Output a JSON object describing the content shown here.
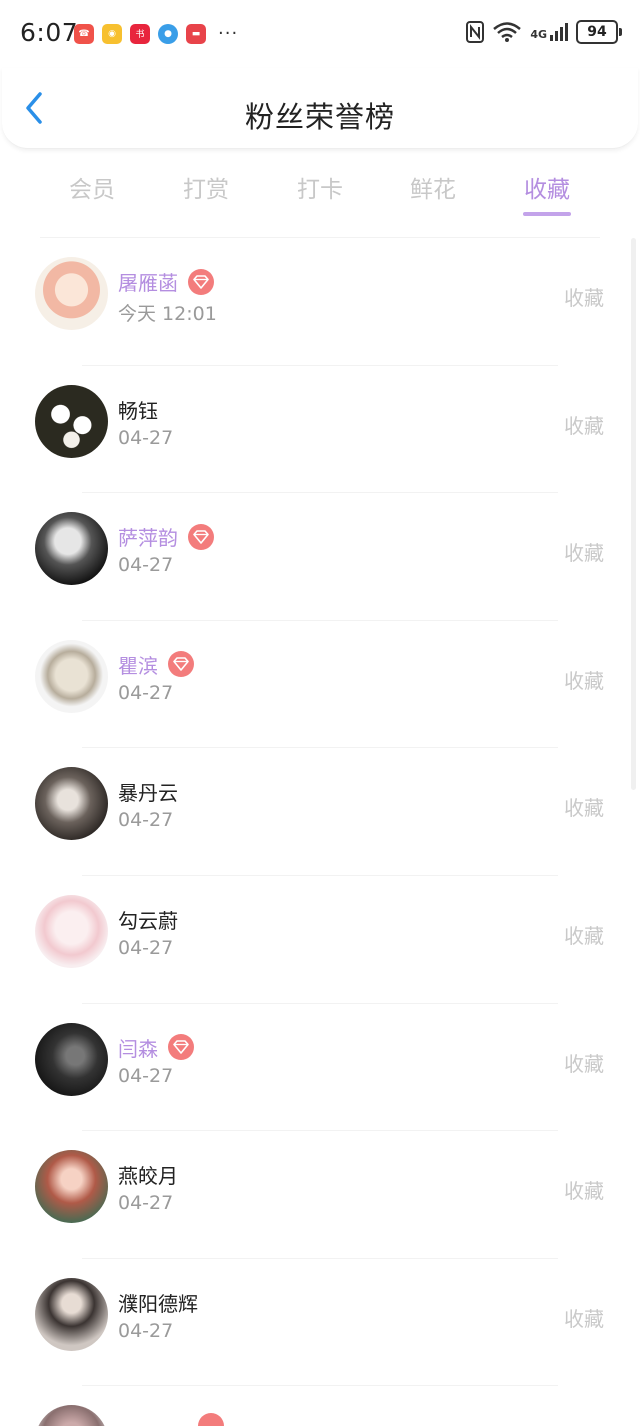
{
  "status_bar": {
    "time": "6:07",
    "network": "4G",
    "battery": "94",
    "app_icons": [
      {
        "name": "call-app-icon",
        "color": "#f0524a"
      },
      {
        "name": "weibo-app-icon",
        "color": "#f7c02f"
      },
      {
        "name": "xiaohongshu-app-icon",
        "color": "#e8253d"
      },
      {
        "name": "blue-app-icon",
        "color": "#3a9ee8"
      },
      {
        "name": "huawei-app-icon",
        "color": "#e8434a"
      }
    ]
  },
  "header": {
    "title": "粉丝荣誉榜"
  },
  "tabs": [
    {
      "label": "会员"
    },
    {
      "label": "打赏"
    },
    {
      "label": "打卡"
    },
    {
      "label": "鲜花"
    },
    {
      "label": "收藏"
    }
  ],
  "active_tab": "收藏",
  "colors": {
    "accent": "#b48ee0",
    "badge": "#f37c7c",
    "back_arrow": "#2a8fe8"
  },
  "fans": [
    {
      "name": "屠雁菡",
      "vip": true,
      "date": "今天 12:01",
      "action": "收藏",
      "avatar": "anime-girl-avatar"
    },
    {
      "name": "畅钰",
      "vip": false,
      "date": "04-27",
      "action": "收藏",
      "avatar": "white-flowers-avatar"
    },
    {
      "name": "萨萍韵",
      "vip": true,
      "date": "04-27",
      "action": "收藏",
      "avatar": "bw-portrait-avatar"
    },
    {
      "name": "瞿滨",
      "vip": true,
      "date": "04-27",
      "action": "收藏",
      "avatar": "skull-avatar"
    },
    {
      "name": "暴丹云",
      "vip": false,
      "date": "04-27",
      "action": "收藏",
      "avatar": "dark-portrait-avatar"
    },
    {
      "name": "勾云蔚",
      "vip": false,
      "date": "04-27",
      "action": "收藏",
      "avatar": "pink-anime-avatar"
    },
    {
      "name": "闫森",
      "vip": true,
      "date": "04-27",
      "action": "收藏",
      "avatar": "masked-man-avatar"
    },
    {
      "name": "燕皎月",
      "vip": false,
      "date": "04-27",
      "action": "收藏",
      "avatar": "girl-photo-avatar"
    },
    {
      "name": "濮阳德辉",
      "vip": false,
      "date": "04-27",
      "action": "收藏",
      "avatar": "dark-girl-avatar"
    }
  ]
}
